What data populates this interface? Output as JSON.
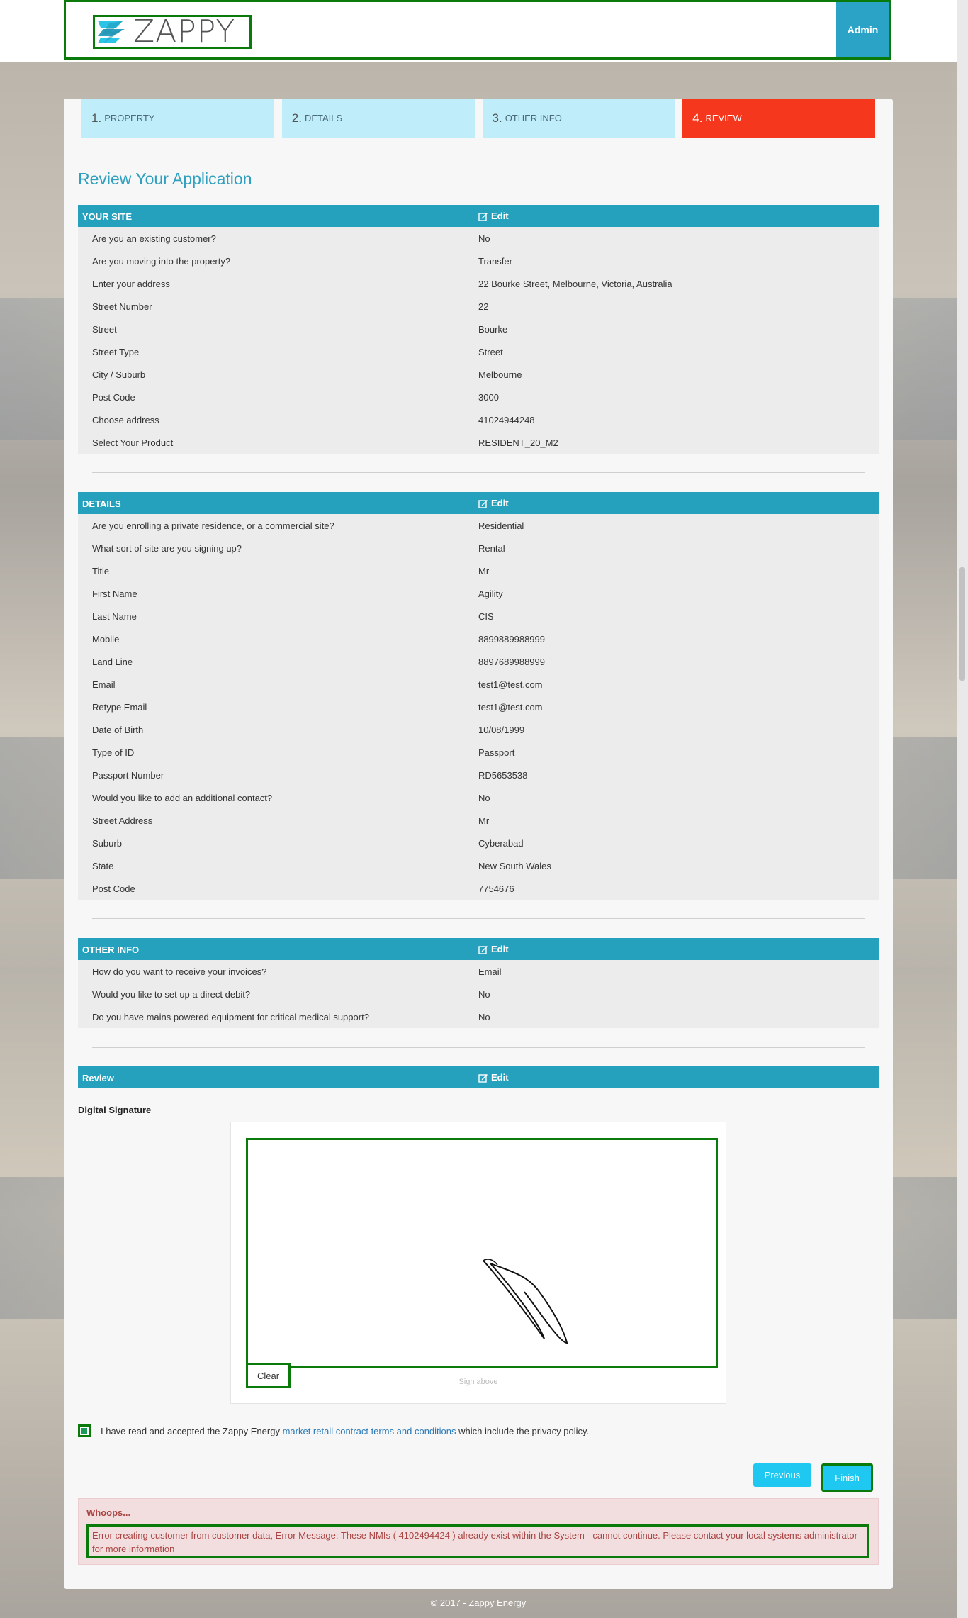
{
  "header": {
    "brand": "ZAPPY",
    "admin_label": "Admin"
  },
  "steps": [
    {
      "num": "1.",
      "label": "PROPERTY"
    },
    {
      "num": "2.",
      "label": "DETAILS"
    },
    {
      "num": "3.",
      "label": "OTHER INFO"
    },
    {
      "num": "4.",
      "label": "REVIEW"
    }
  ],
  "page_title": "Review Your Application",
  "edit_label": "Edit",
  "your_site": {
    "title": "YOUR SITE",
    "rows": [
      {
        "k": "Are you an existing customer?",
        "v": "No"
      },
      {
        "k": "Are you moving into the property?",
        "v": "Transfer"
      },
      {
        "k": "Enter your address",
        "v": "22 Bourke Street, Melbourne, Victoria, Australia"
      },
      {
        "k": "Street Number",
        "v": "22"
      },
      {
        "k": "Street",
        "v": "Bourke"
      },
      {
        "k": "Street Type",
        "v": "Street"
      },
      {
        "k": "City / Suburb",
        "v": "Melbourne"
      },
      {
        "k": "Post Code",
        "v": "3000"
      },
      {
        "k": "Choose address",
        "v": "41024944248"
      },
      {
        "k": "Select Your Product",
        "v": "RESIDENT_20_M2"
      }
    ]
  },
  "details": {
    "title": "DETAILS",
    "rows": [
      {
        "k": "Are you enrolling a private residence, or a commercial site?",
        "v": "Residential"
      },
      {
        "k": "What sort of site are you signing up?",
        "v": "Rental"
      },
      {
        "k": "Title",
        "v": "Mr"
      },
      {
        "k": "First Name",
        "v": "Agility"
      },
      {
        "k": "Last Name",
        "v": "CIS"
      },
      {
        "k": "Mobile",
        "v": "8899889988999"
      },
      {
        "k": "Land Line",
        "v": "8897689988999"
      },
      {
        "k": "Email",
        "v": "test1@test.com"
      },
      {
        "k": "Retype Email",
        "v": "test1@test.com"
      },
      {
        "k": "Date of Birth",
        "v": "10/08/1999"
      },
      {
        "k": "Type of ID",
        "v": "Passport"
      },
      {
        "k": "Passport Number",
        "v": "RD5653538"
      },
      {
        "k": "Would you like to add an additional contact?",
        "v": "No"
      },
      {
        "k": "Street Address",
        "v": "Mr"
      },
      {
        "k": "Suburb",
        "v": "Cyberabad"
      },
      {
        "k": "State",
        "v": "New South Wales"
      },
      {
        "k": "Post Code",
        "v": "7754676"
      }
    ]
  },
  "other_info": {
    "title": "OTHER INFO",
    "rows": [
      {
        "k": "How do you want to receive your invoices?",
        "v": "Email"
      },
      {
        "k": "Would you like to set up a direct debit?",
        "v": "No"
      },
      {
        "k": "Do you have mains powered equipment for critical medical support?",
        "v": "No"
      }
    ]
  },
  "review": {
    "title": "Review",
    "signature_title": "Digital Signature",
    "clear_label": "Clear",
    "sign_above": "Sign above"
  },
  "accept": {
    "checked": true,
    "before": "I have read and accepted the Zappy Energy ",
    "link": "market retail contract terms and conditions",
    "after": " which include the privacy policy."
  },
  "buttons": {
    "previous": "Previous",
    "finish": "Finish"
  },
  "alert": {
    "title": "Whoops...",
    "message": "Error creating customer from customer data, Error Message: These NMIs ( 4102494424 ) already exist within the System - cannot continue. Please contact your local systems administrator for more information"
  },
  "footer": "© 2017 - Zappy Energy",
  "colors": {
    "accent": "#25a1bd",
    "active_step": "#f5381d",
    "step_bg": "#bfeefa",
    "button": "#1ec8f0"
  }
}
